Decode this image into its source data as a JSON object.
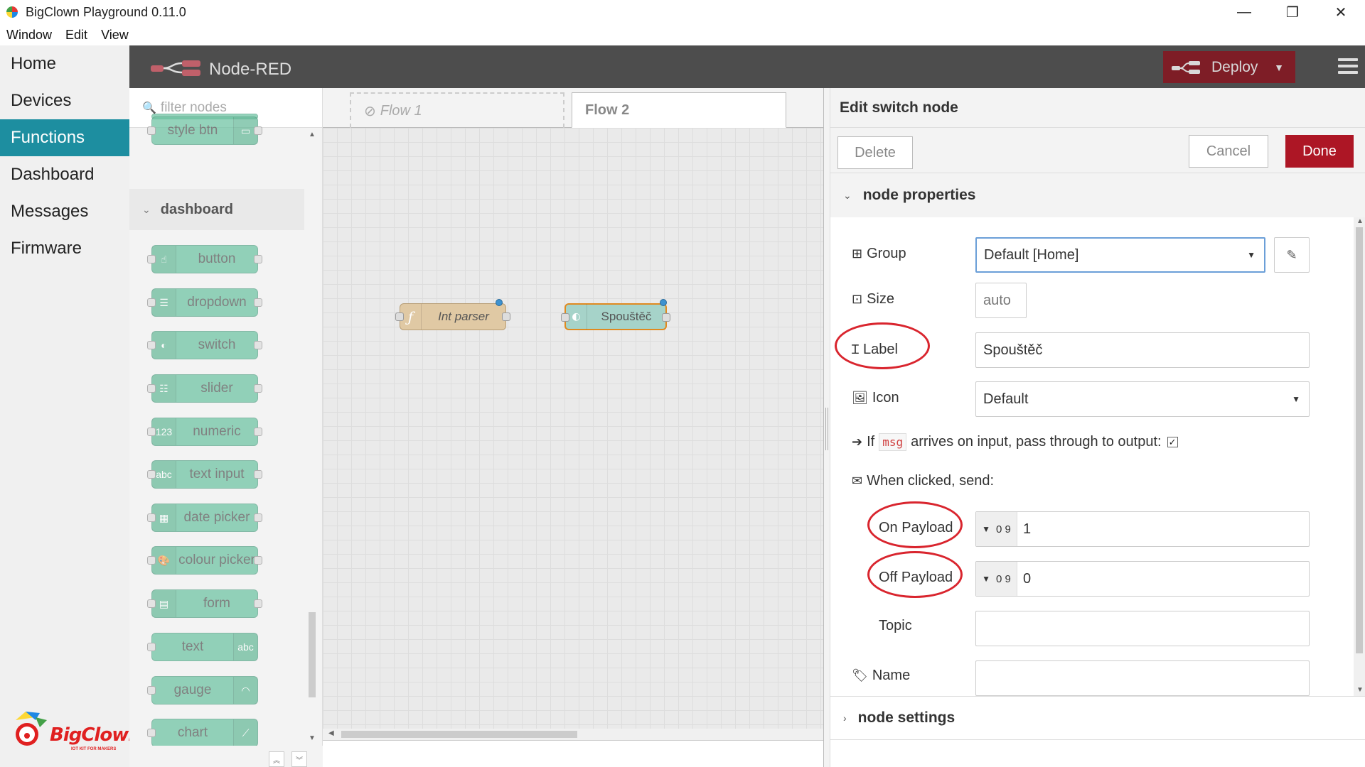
{
  "window": {
    "title": "BigClown Playground 0.11.0",
    "menu": [
      "Window",
      "Edit",
      "View"
    ],
    "controls": {
      "minimize": "—",
      "restore": "❐",
      "close": "✕"
    }
  },
  "app_nav": {
    "items": [
      {
        "label": "Home",
        "active": false
      },
      {
        "label": "Devices",
        "active": false
      },
      {
        "label": "Functions",
        "active": true
      },
      {
        "label": "Dashboard",
        "active": false
      },
      {
        "label": "Messages",
        "active": false
      },
      {
        "label": "Firmware",
        "active": false
      }
    ],
    "logo_text": "BigClown",
    "logo_tagline": "IOT KIT FOR MAKERS",
    "active_color": "#1d8ea0"
  },
  "nodered": {
    "title": "Node-RED",
    "deploy_label": "Deploy",
    "deploy_color": "#8c101c"
  },
  "palette": {
    "filter_placeholder": "filter nodes",
    "top_node": "style btn",
    "category": "dashboard",
    "nodes": [
      {
        "label": "button",
        "icon": "hand-pointer-icon",
        "icon_side": "left"
      },
      {
        "label": "dropdown",
        "icon": "list-icon",
        "icon_side": "left"
      },
      {
        "label": "switch",
        "icon": "toggle-icon",
        "icon_side": "left"
      },
      {
        "label": "slider",
        "icon": "sliders-icon",
        "icon_side": "left"
      },
      {
        "label": "numeric",
        "icon": "123-icon",
        "icon_side": "left"
      },
      {
        "label": "text input",
        "icon": "abc-icon",
        "icon_side": "left"
      },
      {
        "label": "date picker",
        "icon": "calendar-icon",
        "icon_side": "left"
      },
      {
        "label": "colour picker",
        "icon": "palette-icon",
        "icon_side": "left"
      },
      {
        "label": "form",
        "icon": "form-icon",
        "icon_side": "left"
      },
      {
        "label": "text",
        "icon": "abc-icon",
        "icon_side": "right"
      },
      {
        "label": "gauge",
        "icon": "gauge-icon",
        "icon_side": "right"
      },
      {
        "label": "chart",
        "icon": "chart-icon",
        "icon_side": "right"
      }
    ],
    "node_color": "#6cc3a2"
  },
  "workspace": {
    "tabs": [
      {
        "label": "Flow 1",
        "disabled": true
      },
      {
        "label": "Flow 2",
        "active": true
      }
    ],
    "nodes": [
      {
        "label": "Int parser",
        "type": "function",
        "color": "#e0c9a4"
      },
      {
        "label": "Spouštěč",
        "type": "switch",
        "color": "#a6d3c9"
      }
    ]
  },
  "editor": {
    "title": "Edit switch node",
    "delete_label": "Delete",
    "cancel_label": "Cancel",
    "done_label": "Done",
    "done_color": "#ad1625",
    "section_properties": "node properties",
    "section_settings": "node settings",
    "group": {
      "label": "Group",
      "value": "Default [Home]"
    },
    "size": {
      "label": "Size",
      "value": "auto"
    },
    "label_field": {
      "label": "Label",
      "value": "Spouštěč"
    },
    "icon_field": {
      "label": "Icon",
      "value": "Default"
    },
    "passthrough": {
      "prefix": "If",
      "code": "msg",
      "suffix": "arrives on input, pass through to output:",
      "checked": true
    },
    "when_clicked": "When clicked, send:",
    "on_payload": {
      "label": "On Payload",
      "type": "0 9",
      "value": "1"
    },
    "off_payload": {
      "label": "Off Payload",
      "type": "0 9",
      "value": "0"
    },
    "topic": {
      "label": "Topic",
      "value": ""
    },
    "name": {
      "label": "Name",
      "value": ""
    },
    "highlight_color": "#d9252e"
  }
}
